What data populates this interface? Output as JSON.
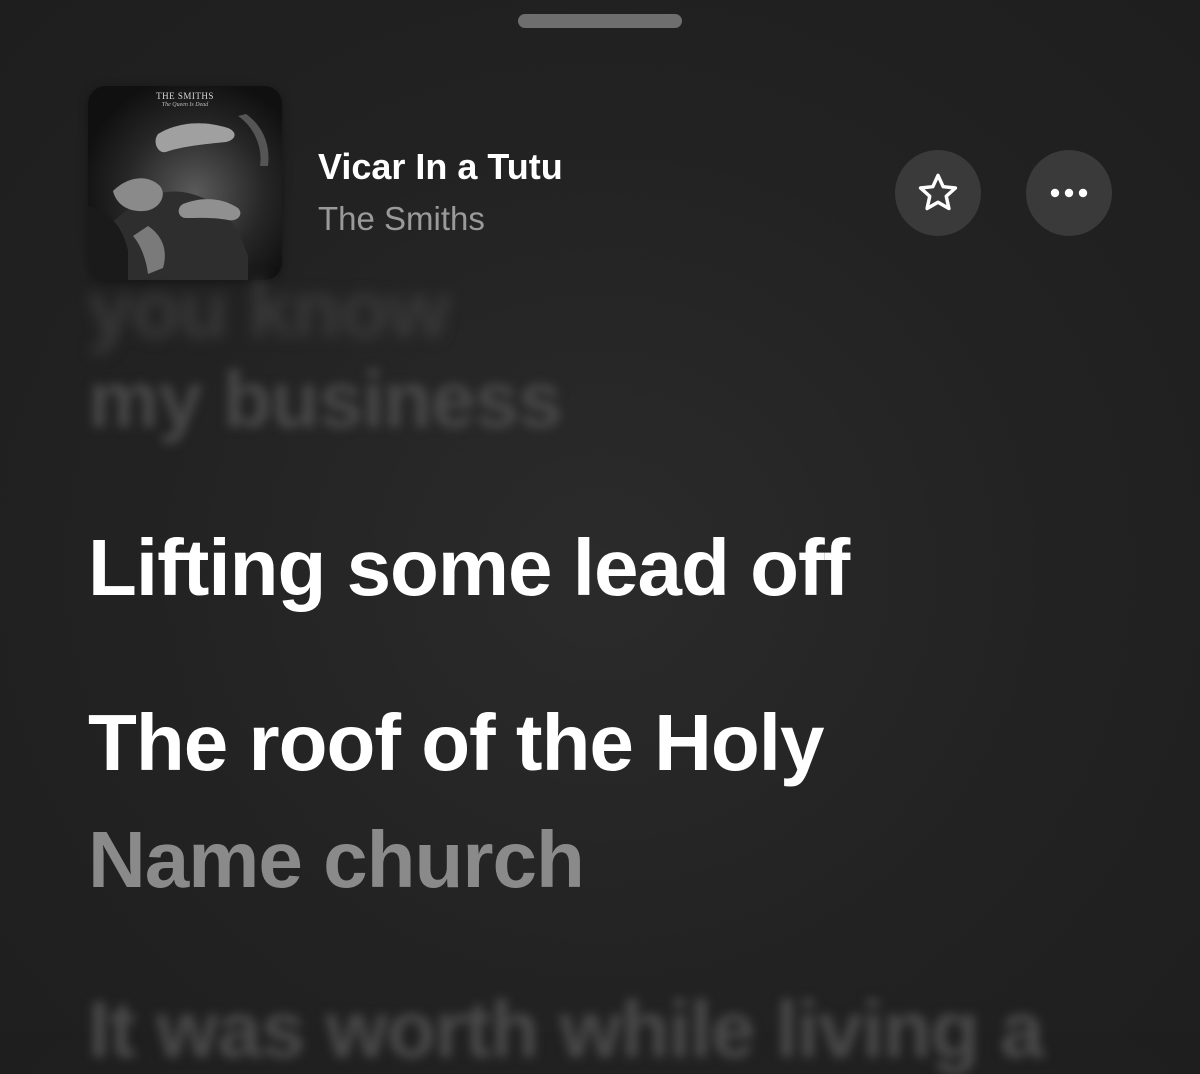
{
  "header": {
    "album_art": {
      "title": "THE SMITHS",
      "subtitle": "The Queen Is Dead"
    },
    "song_title": "Vicar In a Tutu",
    "artist": "The Smiths",
    "favorite_icon": "star-icon",
    "more_icon": "ellipsis-icon"
  },
  "lyrics": {
    "previous_faded": [
      "you know",
      "my business"
    ],
    "active_lines": [
      "Lifting some lead off",
      "The roof of the Holy",
      "Name church"
    ],
    "next_faded": [
      "It was worth while living a"
    ]
  },
  "colors": {
    "background": "#232323",
    "button_bg": "#3a3a3a",
    "active_lyric": "#ffffff",
    "upcoming_lyric": "#8a8a8a",
    "artist_text": "#9a9a9a"
  }
}
